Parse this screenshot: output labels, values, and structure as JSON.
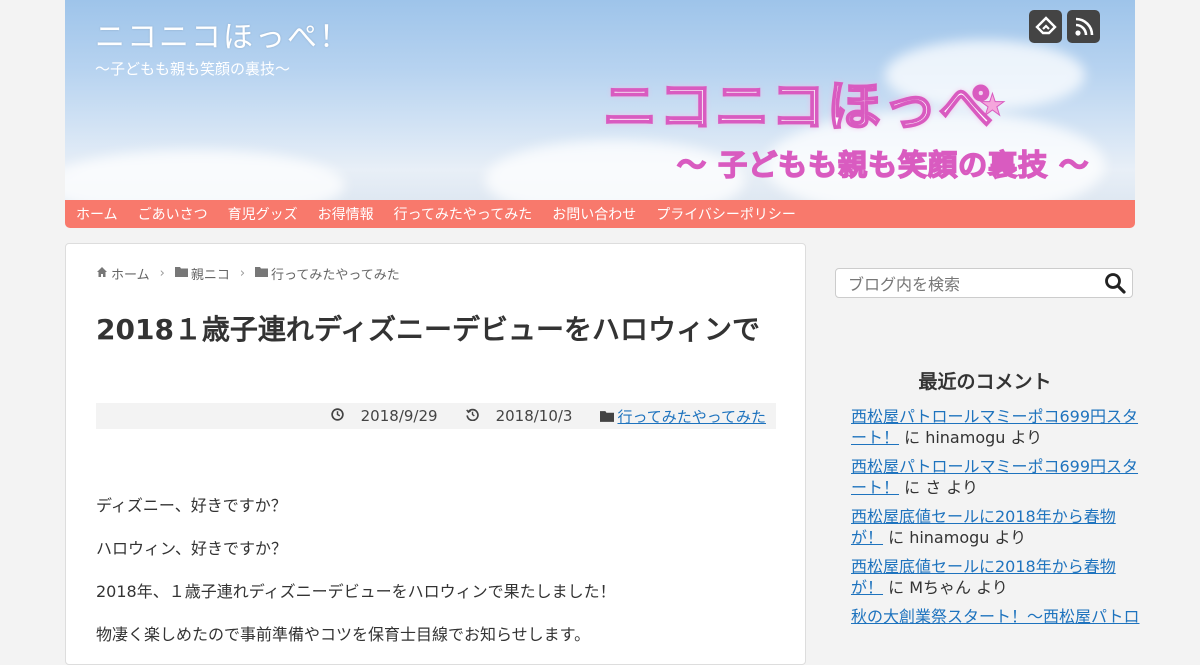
{
  "site": {
    "title": "ニコニコほっぺ！",
    "tagline": "〜子どもも親も笑顔の裏技〜",
    "logo_main": "ニコニコほっぺ",
    "logo_sub": "〜 子どもも親も笑顔の裏技 〜"
  },
  "nav": [
    "ホーム",
    "ごあいさつ",
    "育児グッズ",
    "お得情報",
    "行ってみたやってみた",
    "お問い合わせ",
    "プライバシーポリシー"
  ],
  "breadcrumb": [
    "ホーム",
    "親ニコ",
    "行ってみたやってみた"
  ],
  "article": {
    "title": "2018１歳子連れディズニーデビューをハロウィンで",
    "published": "2018/9/29",
    "updated": "2018/10/3",
    "category": "行ってみたやってみた",
    "paragraphs": [
      "ディズニー、好きですか？",
      "ハロウィン、好きですか？",
      "2018年、１歳子連れディズニーデビューをハロウィンで果たしました！",
      "物凄く楽しめたので事前準備やコツを保育士目線でお知らせします。"
    ]
  },
  "sidebar": {
    "search_placeholder": "ブログ内を検索",
    "widget_title": "最近のコメント",
    "comments": [
      {
        "post": "西松屋パトロールマミーポコ699円スタート！",
        "mid": " に ",
        "author": "hinamogu",
        "suffix": " より"
      },
      {
        "post": "西松屋パトロールマミーポコ699円スタート！",
        "mid": " に ",
        "author": "さ",
        "suffix": " より"
      },
      {
        "post": "西松屋底値セールに2018年から春物が！",
        "mid": " に ",
        "author": "hinamogu",
        "suffix": " より"
      },
      {
        "post": "西松屋底値セールに2018年から春物が！",
        "mid": " に ",
        "author": "Mちゃん",
        "suffix": " より"
      },
      {
        "post": "秋の大創業祭スタート！〜西松屋パトロ",
        "mid": "",
        "author": "",
        "suffix": ""
      }
    ]
  },
  "colors": {
    "nav_bg": "#f8796c",
    "link": "#1e73be",
    "logo_pink": "#d95bc0"
  },
  "icons": [
    "feedly-icon",
    "rss-icon",
    "home-icon",
    "folder-icon",
    "clock-icon",
    "history-icon",
    "search-icon"
  ]
}
